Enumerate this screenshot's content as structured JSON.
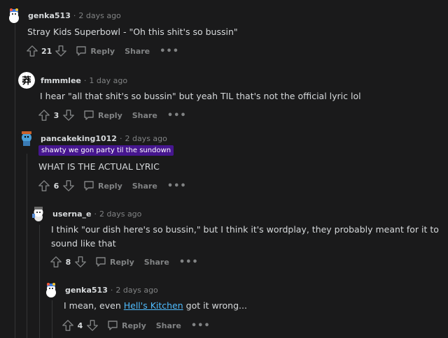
{
  "comments": [
    {
      "username": "genka513",
      "time": "2 days ago",
      "body": "Stray Kids Superbowl - \"Oh this shit's so bussin\"",
      "votes": "21",
      "reply_label": "Reply",
      "share_label": "Share"
    },
    {
      "username": "fmmmlee",
      "time": "1 day ago",
      "body": "I hear \"all that shit's so bussin\" but yeah TIL that's not the official lyric lol",
      "votes": "3",
      "reply_label": "Reply",
      "share_label": "Share"
    },
    {
      "username": "pancakeking1012",
      "time": "2 days ago",
      "flair": "shawty we gon party til the sundown",
      "body": "WHAT IS THE ACTUAL LYRIC",
      "votes": "6",
      "reply_label": "Reply",
      "share_label": "Share"
    },
    {
      "username": "userna_e",
      "time": "2 days ago",
      "body": "I think \"our dish here's so bussin,\" but I think it's wordplay, they probably meant for it to sound like that",
      "votes": "8",
      "reply_label": "Reply",
      "share_label": "Share"
    },
    {
      "username": "genka513",
      "time": "2 days ago",
      "body_before": "I mean, even ",
      "body_link": "Hell's Kitchen",
      "body_after": " got it wrong...",
      "votes": "4",
      "reply_label": "Reply",
      "share_label": "Share"
    }
  ],
  "colors": {
    "background": "#1a1a1b",
    "text": "#d7dadc",
    "meta": "#818384",
    "flair_bg": "#46168f",
    "link": "#4fbcff"
  }
}
